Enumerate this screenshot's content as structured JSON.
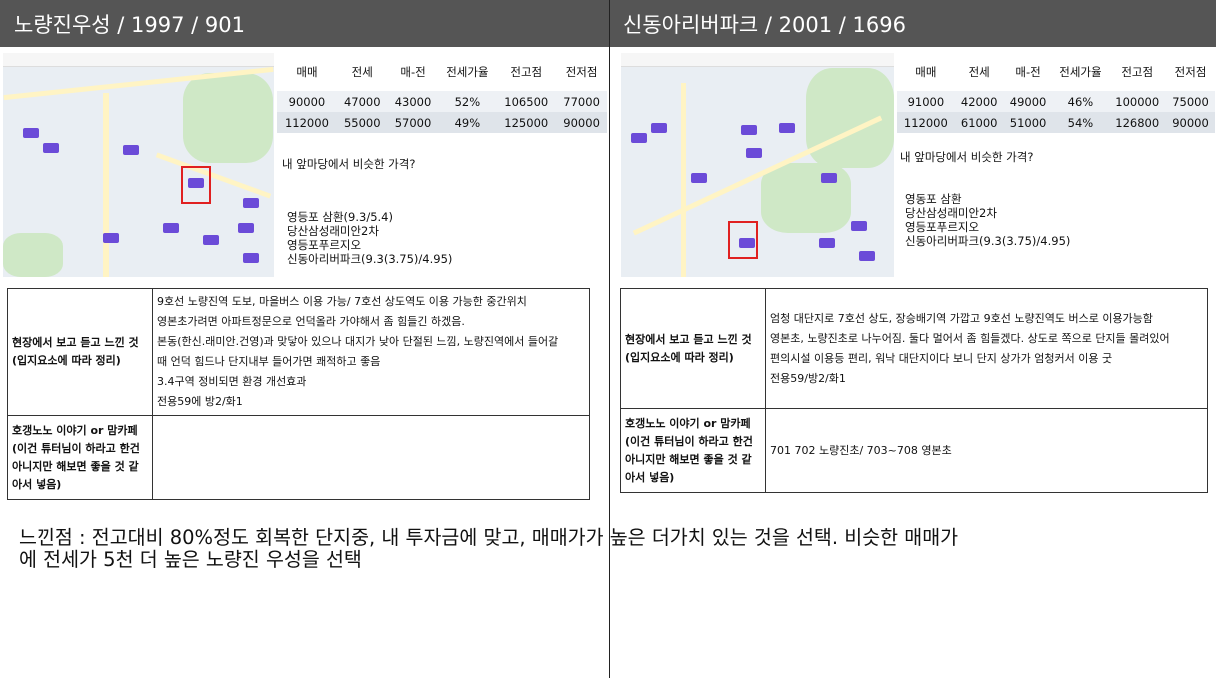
{
  "left": {
    "title": "노량진우성 / 1997 / 901",
    "table_headers": [
      "매매",
      "전세",
      "매-전",
      "전세가율",
      "전고점",
      "전저점"
    ],
    "rows": [
      [
        "90000",
        "47000",
        "43000",
        "52%",
        "106500",
        "77000"
      ],
      [
        "112000",
        "55000",
        "57000",
        "49%",
        "125000",
        "90000"
      ]
    ],
    "question": "내 앞마당에서 비슷한 가격?",
    "similar": [
      "영등포 삼환(9.3/5.4)",
      "당산삼성래미안2차",
      "영등포푸르지오",
      "신동아리버파크(9.3(3.75)/4.95)"
    ],
    "field_label": [
      "현장에서 보고 듣고 느낀 것",
      "(입지요소에 따라 정리)"
    ],
    "field_lines": [
      "9호선 노량진역 도보, 마을버스 이용 가능/ 7호선 상도역도 이용 가능한 중간위치",
      "영본초가려면  아파트정문으로  언덕올라 가야해서 좀 힘들긴 하겠음.",
      "본동(한신.래미안.건영)과  맞닿아 있으나 대지가 낮아 단절된 느낌, 노량진역에서  들어갈",
      "때 언덕 힘드나 단지내부 들어가면  쾌적하고 좋음",
      "3.4구역 정비되면 환경 개선효과",
      "전용59에 방2/화1"
    ],
    "talk_label": [
      "호갱노노 이야기 or 맘카페",
      "(이건 튜터님이 하라고 한건",
      "아니지만 해보면 좋을 것 같",
      "아서 넣음)"
    ],
    "talk_text": ""
  },
  "right": {
    "title": "신동아리버파크 / 2001 / 1696",
    "table_headers": [
      "매매",
      "전세",
      "매-전",
      "전세가율",
      "전고점",
      "전저점"
    ],
    "rows": [
      [
        "91000",
        "42000",
        "49000",
        "46%",
        "100000",
        "75000"
      ],
      [
        "112000",
        "61000",
        "51000",
        "54%",
        "126800",
        "90000"
      ]
    ],
    "question": "내 앞마당에서 비슷한 가격?",
    "similar": [
      "영동포 삼환",
      "당산삼성래미안2차",
      "영등포푸르지오",
      "신동아리버파크(9.3(3.75)/4.95)"
    ],
    "field_label": [
      "현장에서 보고 듣고 느낀 것",
      "(입지요소에 따라 정리)"
    ],
    "field_lines": [
      "엄청 대단지로 7호선 상도, 장승배기역  가깝고  9호선  노량진역도 버스로 이용가능함",
      "영본초, 노량진초로  나누어짐. 둘다 멀어서 좀 힘들겠다. 상도로 쪽으로 단지들 몰려있어",
      "편의시설 이용등 편리, 워낙 대단지이다 보니 단지 상가가 엄청커서 이용 굿",
      "전용59/방2/화1"
    ],
    "talk_label": [
      "호갱노노 이야기 or 맘카페",
      "(이건 튜터님이 하라고 한건",
      "아니지만 해보면 좋을 것 같",
      "아서 넣음)"
    ],
    "talk_text": "701 702 노량진초/ 703~708 영본초"
  },
  "conclusion": [
    "느낀점 : 전고대비 80%정도 회복한 단지중, 내 투자금에 맞고, 매매가가 높은 더가치 있는 것을 선택. 비슷한 매매가",
    "에 전세가 5천 더 높은 노량진 우성을 선택"
  ]
}
